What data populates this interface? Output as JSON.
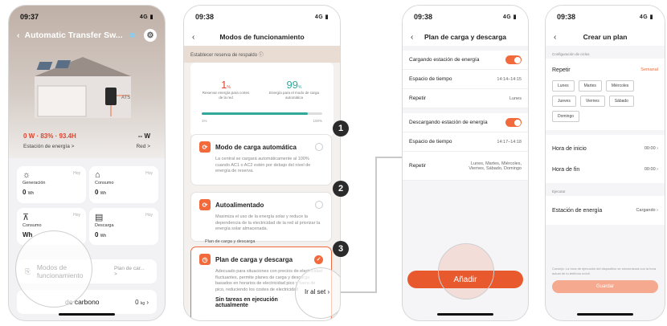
{
  "p1": {
    "time": "09:37",
    "signal": "4G",
    "title": "Automatic Transfer Sw...",
    "power": "0 W · 83% · 93.4H",
    "grid_power": "-- W",
    "station_link": "Estación de energía >",
    "grid_link": "Red >",
    "ats_label": "ATS",
    "tiles": [
      {
        "label": "Generación",
        "hoy": "Hoy",
        "value": "0",
        "unit": "Wh"
      },
      {
        "label": "Consumo",
        "hoy": "Hoy",
        "value": "0",
        "unit": "Wh"
      },
      {
        "label": "Consumo",
        "hoy": "Hoy",
        "value": "Wh",
        "unit": ""
      },
      {
        "label": "Descarga",
        "hoy": "Hoy",
        "value": "0",
        "unit": "Wh"
      }
    ],
    "modes_row": "Modos de funcionamiento",
    "modes_value": "Plan de car... >",
    "carbon_row": "de carbono",
    "carbon_value": "0",
    "carbon_unit": "kg"
  },
  "p2": {
    "time": "09:38",
    "signal": "4G",
    "title": "Modos de funcionamiento",
    "reserve_label": "Establecer reserva de respaldo",
    "left_value": "1",
    "left_unit": "%",
    "left_caption": "Reservar energía para cortes de la red",
    "right_value": "99",
    "right_unit": "%",
    "right_caption": "Energía para el modo de carga automática",
    "min": "1%",
    "max": "100%",
    "modes": [
      {
        "title": "Modo de carga automática",
        "desc": "La central se cargará automáticamente al 100% cuando AC1 o AC2 estén por debajo del nivel de energía de reserva."
      },
      {
        "title": "Autoalimentado",
        "desc": "Maximiza el uso de la energía solar y reduce la dependencia de la electricidad de la red al priorizar la energía solar almacenada."
      },
      {
        "title": "Plan de carga y descarga",
        "desc": "Adecuado para situaciones con precios de electricidad fluctuantes, permite planes de carga y descarga basados en horarios de electricidad pico y fuera de pico, reduciendo los costes de electricidad"
      }
    ],
    "peek_label": "Plan de carga y descarga",
    "no_tasks": "Sin tareas en ejecución actualmente",
    "go_set": "Ir al set",
    "callouts": [
      "1",
      "2",
      "3"
    ]
  },
  "p3": {
    "time": "09:38",
    "signal": "4G",
    "title": "Plan de carga y descarga",
    "charging_label": "Cargando estación de energía",
    "time_label": "Espacio de tiempo",
    "charging_time": "14:14–14:15",
    "repeat_label": "Repetir",
    "charging_repeat": "Lunes",
    "discharging_label": "Descargando estación de energía",
    "discharging_time": "14:17–14:18",
    "discharging_repeat": "Lunes, Martes, Miércoles, Viernes, Sábado, Domingo",
    "add_button": "Añadir"
  },
  "p4": {
    "time": "09:38",
    "signal": "4G",
    "title": "Crear un plan",
    "cycle_group": "Configuración de ciclos",
    "repeat_label": "Repetir",
    "repeat_value": "Semanal",
    "days": [
      "Lunes",
      "Martes",
      "Miércoles",
      "Jueves",
      "Viernes",
      "Sábado",
      "Domingo"
    ],
    "start_label": "Hora de inicio",
    "start_value": "00:00",
    "end_label": "Hora de fin",
    "end_value": "00:00",
    "exec_group": "Ejecutar",
    "station_label": "Estación de energía",
    "station_value": "Cargando",
    "note": "Consejo: La hora de ejecución del dispositivo se sincronizará con la hora actual de tu teléfono móvil.",
    "save_button": "Guardar"
  },
  "colors": {
    "accent": "#f26a3c",
    "green": "#30a89a",
    "red": "#e0432c"
  }
}
